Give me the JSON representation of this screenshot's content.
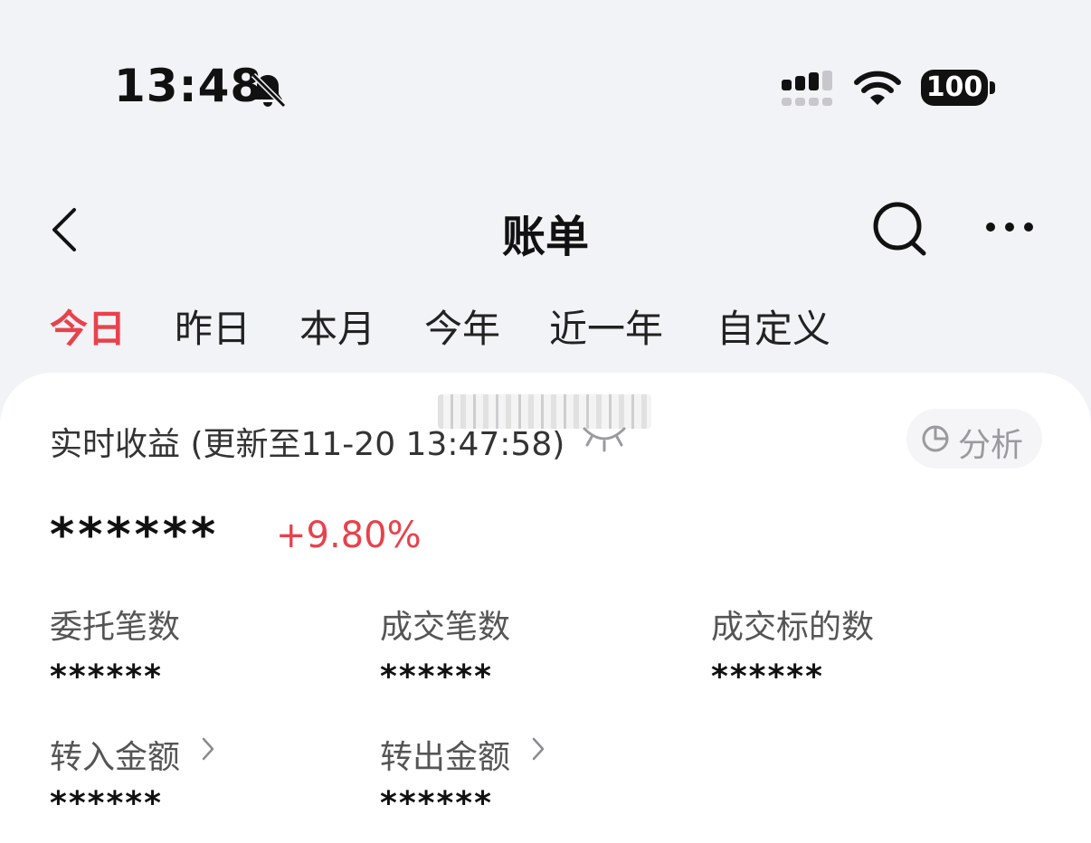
{
  "status_bar": {
    "time": "13:48",
    "battery": "100",
    "icons": [
      "bell-muted-icon",
      "cellular-signal-icon",
      "wifi-icon",
      "battery-icon"
    ]
  },
  "nav": {
    "title": "账单",
    "icons": [
      "back-chevron-icon",
      "search-icon",
      "more-icon"
    ]
  },
  "tabs": [
    {
      "label": "今日",
      "active": true
    },
    {
      "label": "昨日",
      "active": false
    },
    {
      "label": "本月",
      "active": false
    },
    {
      "label": "今年",
      "active": false
    },
    {
      "label": "近一年",
      "active": false
    },
    {
      "label": "自定义",
      "active": false
    }
  ],
  "summary": {
    "realtime_label": "实时收益 (更新至11-20 13:47:58)",
    "analyze_label": "分析",
    "masked_profit": "******",
    "profit_pct": "+9.80%"
  },
  "stats": {
    "orders": {
      "label": "委托笔数",
      "value": "******"
    },
    "deals": {
      "label": "成交笔数",
      "value": "******"
    },
    "targets": {
      "label": "成交标的数",
      "value": "******"
    },
    "transfer_in": {
      "label": "转入金额",
      "value": "******"
    },
    "transfer_out": {
      "label": "转出金额",
      "value": "******"
    }
  },
  "colors": {
    "accent_red": "#e8424c",
    "page_bg": "#f2f3f7",
    "card_bg": "#ffffff"
  }
}
